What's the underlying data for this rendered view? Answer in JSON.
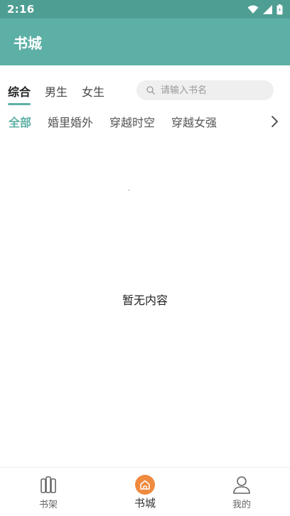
{
  "status_bar": {
    "time": "2:16"
  },
  "app_bar": {
    "title": "书城"
  },
  "tabs": [
    {
      "label": "综合",
      "active": true
    },
    {
      "label": "男生",
      "active": false
    },
    {
      "label": "女生",
      "active": false
    }
  ],
  "search": {
    "placeholder": "请输入书名",
    "value": ""
  },
  "categories": [
    {
      "label": "全部",
      "active": true
    },
    {
      "label": "婚里婚外",
      "active": false
    },
    {
      "label": "穿越时空",
      "active": false
    },
    {
      "label": "穿越女强",
      "active": false
    }
  ],
  "empty_state": {
    "text": "暂无内容"
  },
  "bottom_nav": [
    {
      "label": "书架",
      "icon": "bookshelf-icon",
      "active": false
    },
    {
      "label": "书城",
      "icon": "home-icon",
      "active": true
    },
    {
      "label": "我的",
      "icon": "profile-icon",
      "active": false
    }
  ],
  "colors": {
    "status_bar": "#4e9e93",
    "app_bar": "#5db0a5",
    "accent": "#5db0a5",
    "home_badge": "#f08a3e"
  }
}
